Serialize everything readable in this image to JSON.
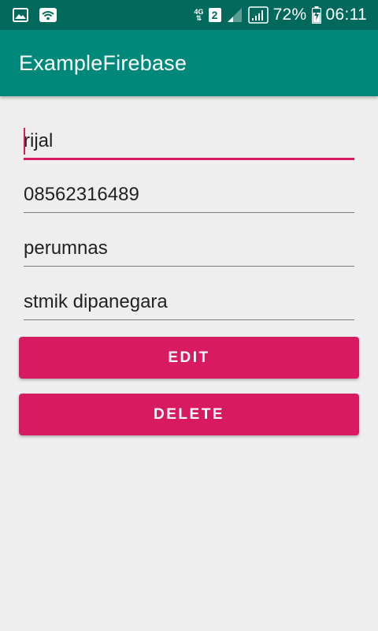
{
  "status_bar": {
    "icons_left": [
      "gallery-icon",
      "wifi-icon"
    ],
    "network_type": "4G",
    "sim_slot": "2",
    "battery_percent": "72%",
    "time": "06:11"
  },
  "toolbar": {
    "title": "ExampleFirebase"
  },
  "form": {
    "name_value": "rijal",
    "phone_value": "08562316489",
    "address_value": "perumnas",
    "school_value": "stmik dipanegara"
  },
  "buttons": {
    "edit_label": "EDIT",
    "delete_label": "DELETE"
  },
  "colors": {
    "status_bar": "#00695c",
    "toolbar": "#00897b",
    "accent": "#d81b60",
    "background": "#eeeeee"
  }
}
